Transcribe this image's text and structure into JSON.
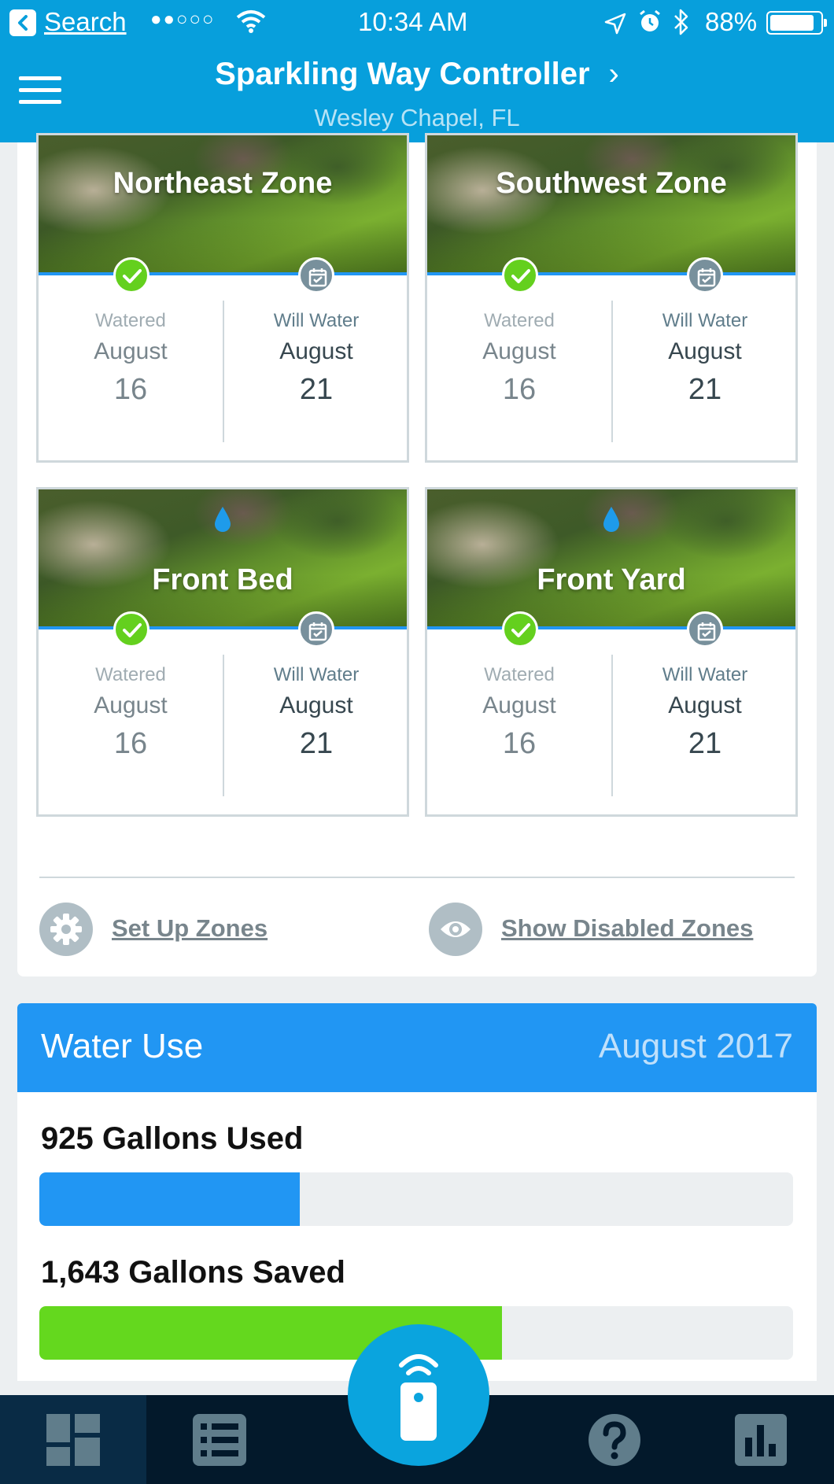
{
  "status_bar": {
    "back_label": "Search",
    "signal": "●●○○○",
    "time": "10:34 AM",
    "battery": "88%"
  },
  "header": {
    "title": "Sparkling Way Controller",
    "chevron": "›",
    "subtitle": "Wesley Chapel, FL"
  },
  "zones": [
    {
      "name": "Northeast Zone",
      "watered_label": "Watered",
      "watered_month": "August",
      "watered_day": "16",
      "next_label": "Will Water",
      "next_month": "August",
      "next_day": "21"
    },
    {
      "name": "Southwest Zone",
      "watered_label": "Watered",
      "watered_month": "August",
      "watered_day": "16",
      "next_label": "Will Water",
      "next_month": "August",
      "next_day": "21"
    },
    {
      "name": "Front Bed",
      "watered_label": "Watered",
      "watered_month": "August",
      "watered_day": "16",
      "next_label": "Will Water",
      "next_month": "August",
      "next_day": "21"
    },
    {
      "name": "Front Yard",
      "watered_label": "Watered",
      "watered_month": "August",
      "watered_day": "16",
      "next_label": "Will Water",
      "next_month": "August",
      "next_day": "21"
    }
  ],
  "zone_actions": {
    "setup": "Set Up Zones",
    "show_disabled": "Show Disabled Zones"
  },
  "water_use": {
    "title": "Water Use",
    "month": "August 2017",
    "used_label": "925 Gallons Used",
    "used_fraction": 0.345,
    "saved_label": "1,643 Gallons Saved",
    "saved_fraction": 0.614
  },
  "colors": {
    "brand_blue": "#079fdc",
    "accent_blue": "#2196f3",
    "saved_green": "#64d81e",
    "tabbar": "#03192b"
  },
  "tabs": [
    "dashboard-icon",
    "schedule-list-icon",
    "remote-icon",
    "help-icon",
    "reports-icon"
  ]
}
